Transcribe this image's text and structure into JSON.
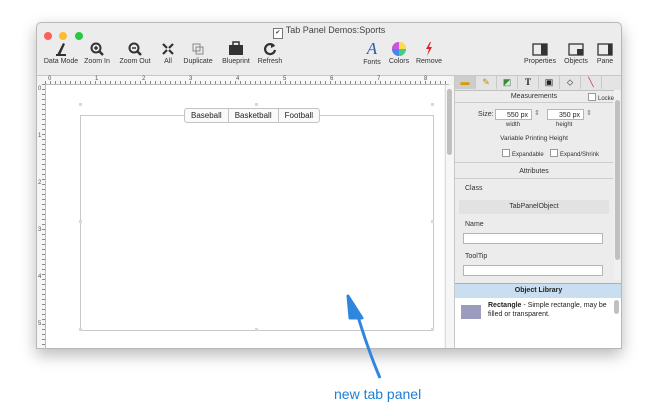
{
  "window": {
    "title": "Tab Panel Demos:Sports"
  },
  "toolbar": {
    "left": [
      {
        "label": "Data Mode",
        "icon": "data-mode-icon"
      },
      {
        "label": "Zoom In",
        "icon": "zoom-in-icon"
      },
      {
        "label": "Zoom Out",
        "icon": "zoom-out-icon"
      },
      {
        "label": "All",
        "icon": "zoom-all-icon"
      },
      {
        "label": "Duplicate",
        "icon": "duplicate-icon"
      },
      {
        "label": "Blueprint",
        "icon": "blueprint-icon"
      },
      {
        "label": "Refresh",
        "icon": "refresh-icon"
      }
    ],
    "middle": [
      {
        "label": "Fonts",
        "icon": "fonts-icon"
      },
      {
        "label": "Colors",
        "icon": "colors-icon"
      },
      {
        "label": "Remove",
        "icon": "remove-icon"
      }
    ],
    "right": [
      {
        "label": "Properties",
        "icon": "properties-icon"
      },
      {
        "label": "Objects",
        "icon": "objects-icon"
      },
      {
        "label": "Pane",
        "icon": "pane-icon"
      }
    ]
  },
  "ruler": {
    "marks": [
      "0",
      "1",
      "2",
      "3",
      "4",
      "5",
      "6",
      "7",
      "8"
    ],
    "vmarks": [
      "0",
      "1",
      "2",
      "3",
      "4",
      "5"
    ]
  },
  "tab_panel": {
    "tabs": [
      "Baseball",
      "Basketball",
      "Football"
    ]
  },
  "inspector": {
    "measurements_title": "Measurements",
    "locked_label": "Locked",
    "size_label": "Size:",
    "width_value": "550 px",
    "height_value": "350 px",
    "width_label": "width",
    "height_label": "height",
    "variable_height_title": "Variable Printing Height",
    "expandable_label": "Expandable",
    "expand_shrink_label": "Expand/Shrink",
    "attributes_title": "Attributes",
    "class_label": "Class",
    "class_value": "TabPanelObject",
    "name_label": "Name",
    "name_value": "",
    "tooltip_label": "ToolTip",
    "tooltip_value": ""
  },
  "object_library": {
    "title": "Object Library",
    "item_name": "Rectangle",
    "item_desc": " - Simple rectangle, may be filled or transparent."
  },
  "annotation": {
    "text": "new tab panel"
  },
  "colors": {
    "accent_blue": "#1b7fd6",
    "library_header": "#c9def0",
    "close": "#fc5f57",
    "minimize": "#fdbc2e",
    "zoom": "#28c840"
  }
}
